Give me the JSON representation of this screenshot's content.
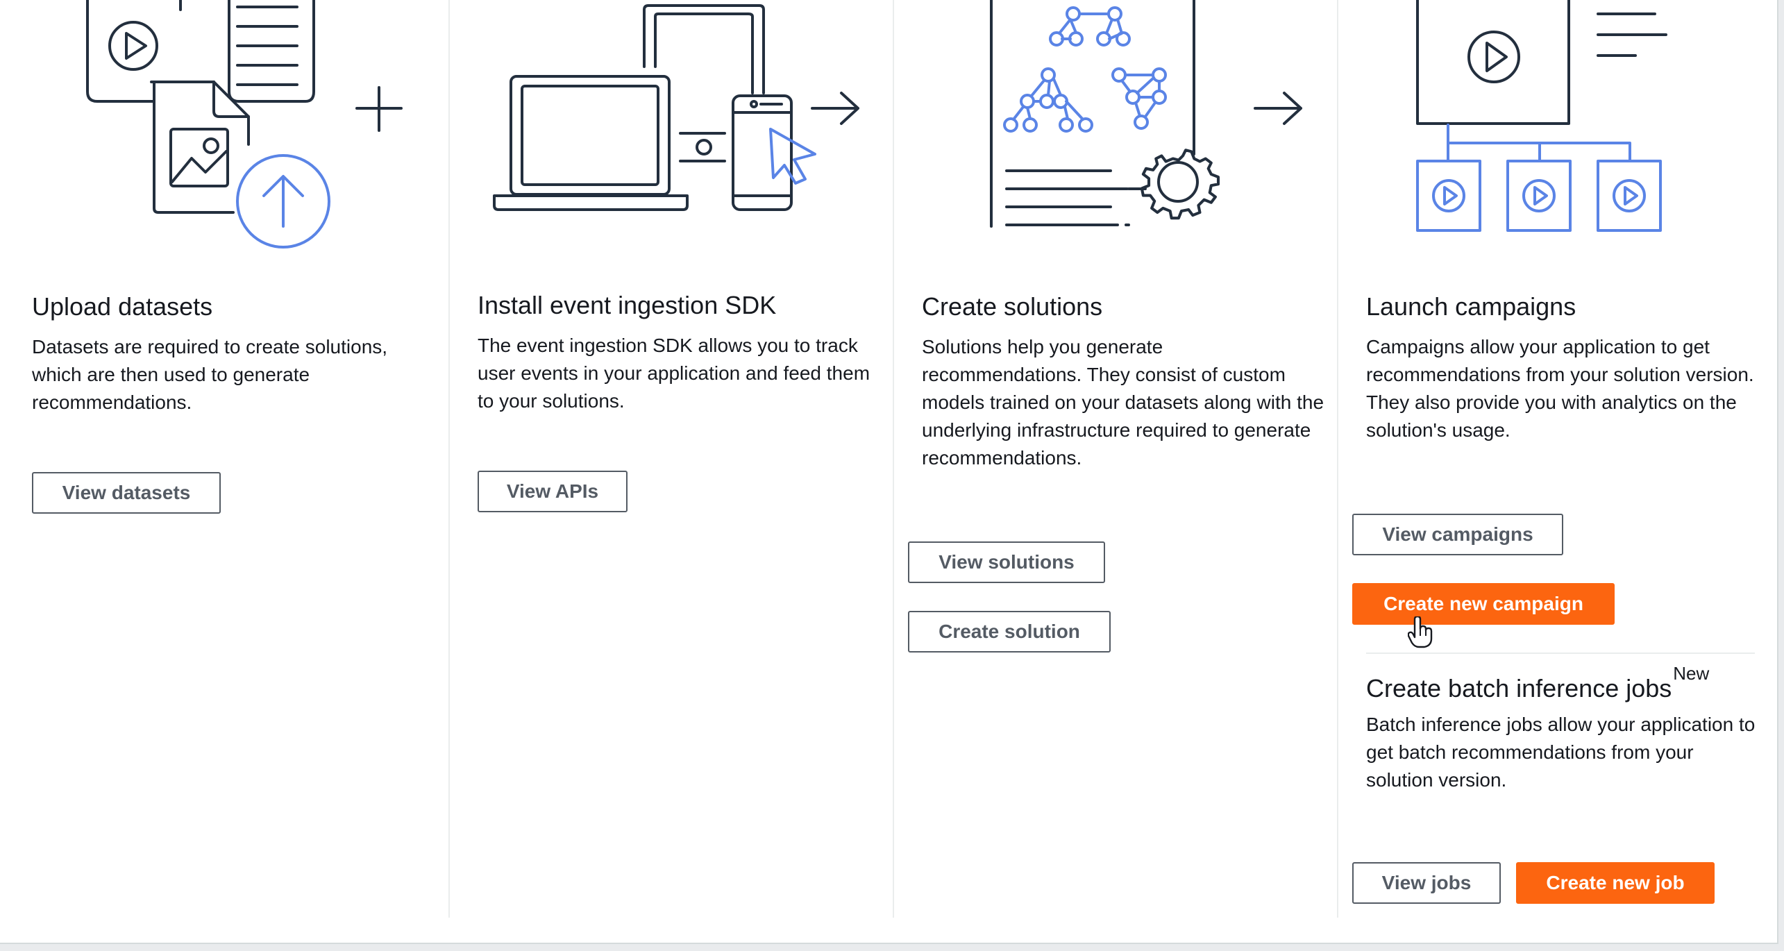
{
  "colors": {
    "primary_button": "#fc6510",
    "normal_button_border": "#545b64",
    "icon_dark": "#232f3e",
    "icon_blue": "#5a84e6"
  },
  "cards": [
    {
      "title": "Upload datasets",
      "description": "Datasets are required to create solutions, which are then used to generate recommendations.",
      "buttons": [
        "View datasets"
      ],
      "illustration": "upload-datasets-illustration"
    },
    {
      "title": "Install event ingestion SDK",
      "description": "The event ingestion SDK allows you to track user events in your application and feed them to your solutions.",
      "buttons": [
        "View APIs"
      ],
      "illustration": "devices-illustration"
    },
    {
      "title": "Create solutions",
      "description": "Solutions help you generate recommendations. They consist of custom models trained on your datasets along with the underlying infrastructure required to generate recommendations.",
      "buttons": [
        "View solutions",
        "Create solution"
      ],
      "illustration": "solutions-illustration"
    },
    {
      "title": "Launch campaigns",
      "description": "Campaigns allow your application to get recommendations from your solution version. They also provide you with analytics on the solution's usage.",
      "buttons": [
        "View campaigns",
        "Create new campaign"
      ],
      "illustration": "campaigns-illustration"
    }
  ],
  "batch": {
    "title": "Create batch inference jobs",
    "badge": "New",
    "description": "Batch inference jobs allow your application to get batch recommendations from your solution version.",
    "buttons": [
      "View jobs",
      "Create new job"
    ]
  }
}
